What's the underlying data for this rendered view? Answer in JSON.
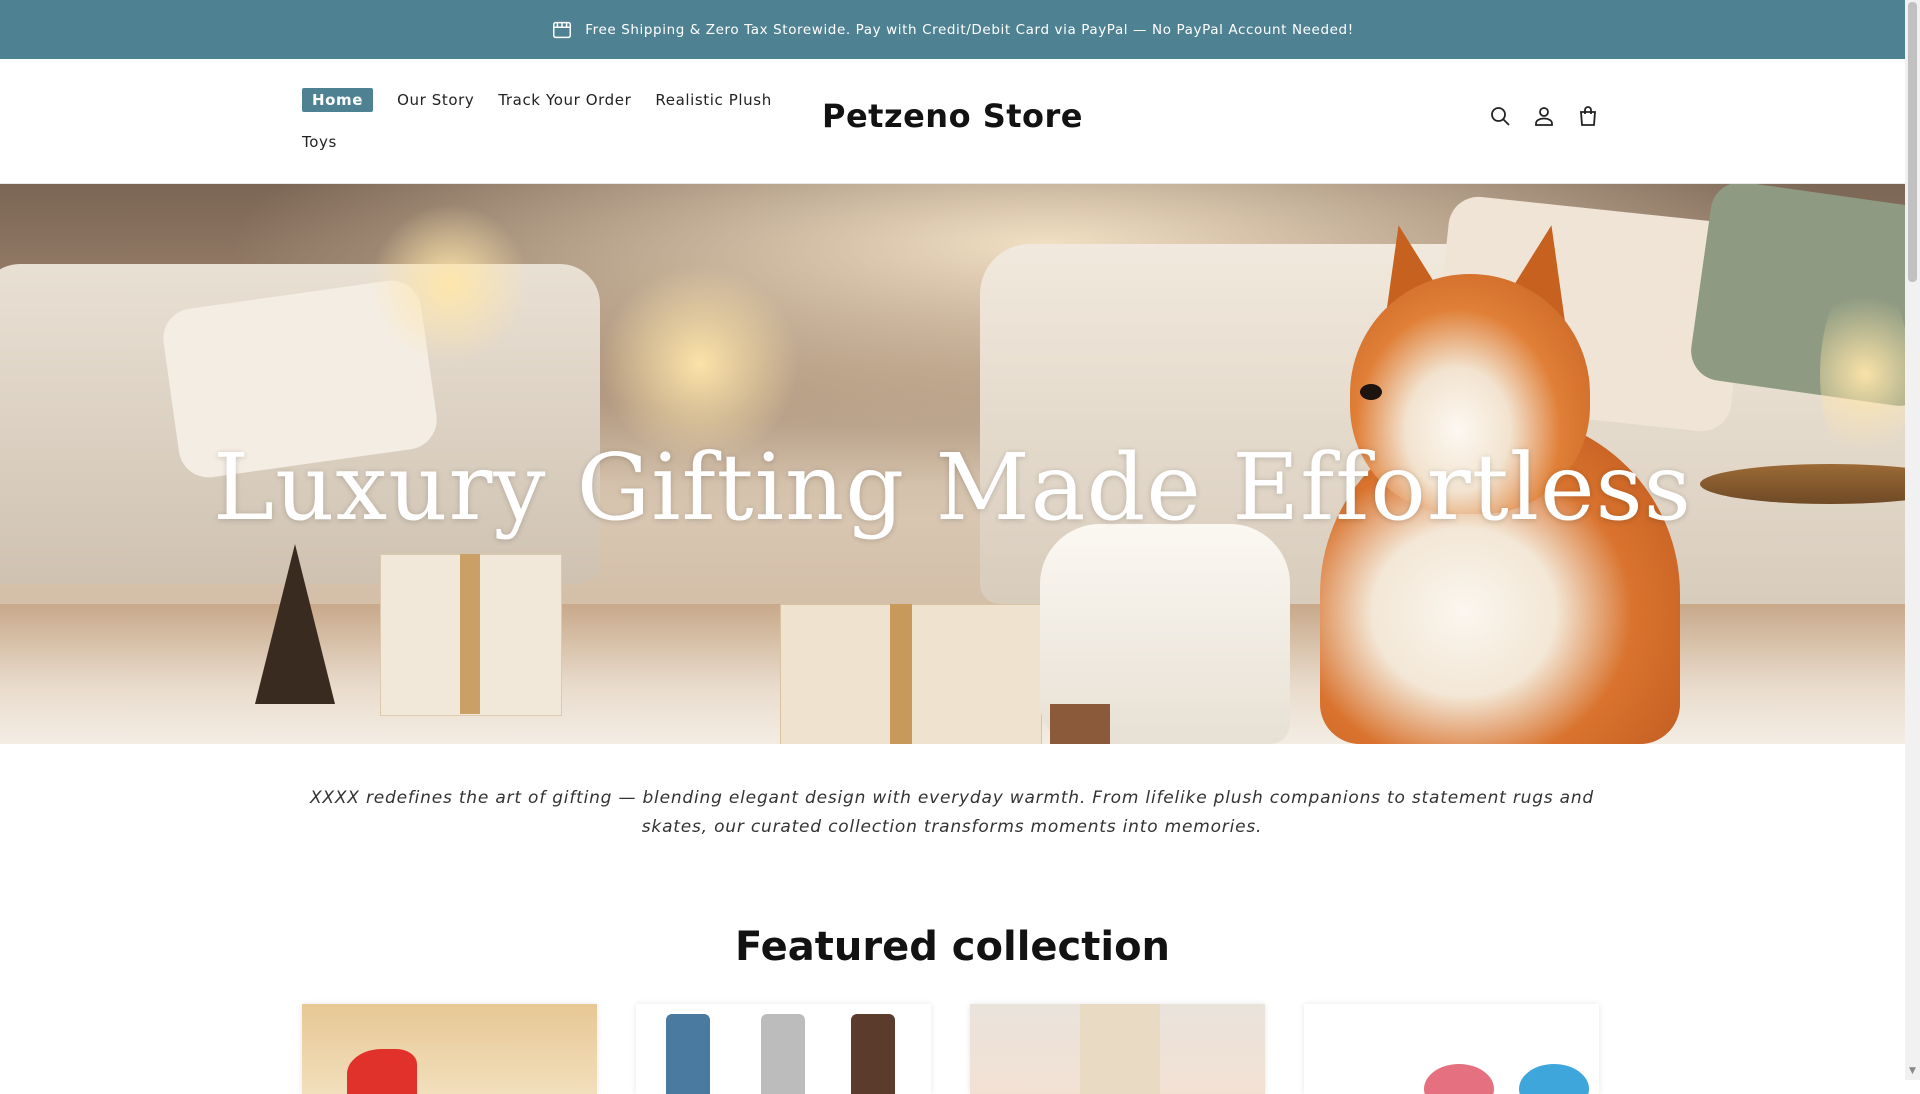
{
  "announcement": {
    "icon": "store-icon",
    "text": "Free Shipping & Zero Tax Storewide. Pay with Credit/Debit Card via PayPal — No PayPal Account Needed!"
  },
  "header": {
    "logo": "Petzeno Store",
    "nav": [
      {
        "label": "Home",
        "active": true
      },
      {
        "label": "Our Story",
        "active": false
      },
      {
        "label": "Track Your Order",
        "active": false
      },
      {
        "label": "Realistic Plush",
        "active": false
      },
      {
        "label": "Toys",
        "active": false
      }
    ],
    "icons": [
      "search-icon",
      "account-icon",
      "cart-icon"
    ]
  },
  "hero": {
    "title": "Luxury Gifting Made Effortless"
  },
  "intro": {
    "text": "XXXX redefines the art of gifting — blending elegant design with everyday warmth. From lifelike plush companions to statement rugs and skates, our curated collection transforms moments into memories."
  },
  "featured": {
    "title": "Featured collection",
    "cards": 4
  },
  "colors": {
    "accent": "#4e8293",
    "text": "#121212"
  }
}
